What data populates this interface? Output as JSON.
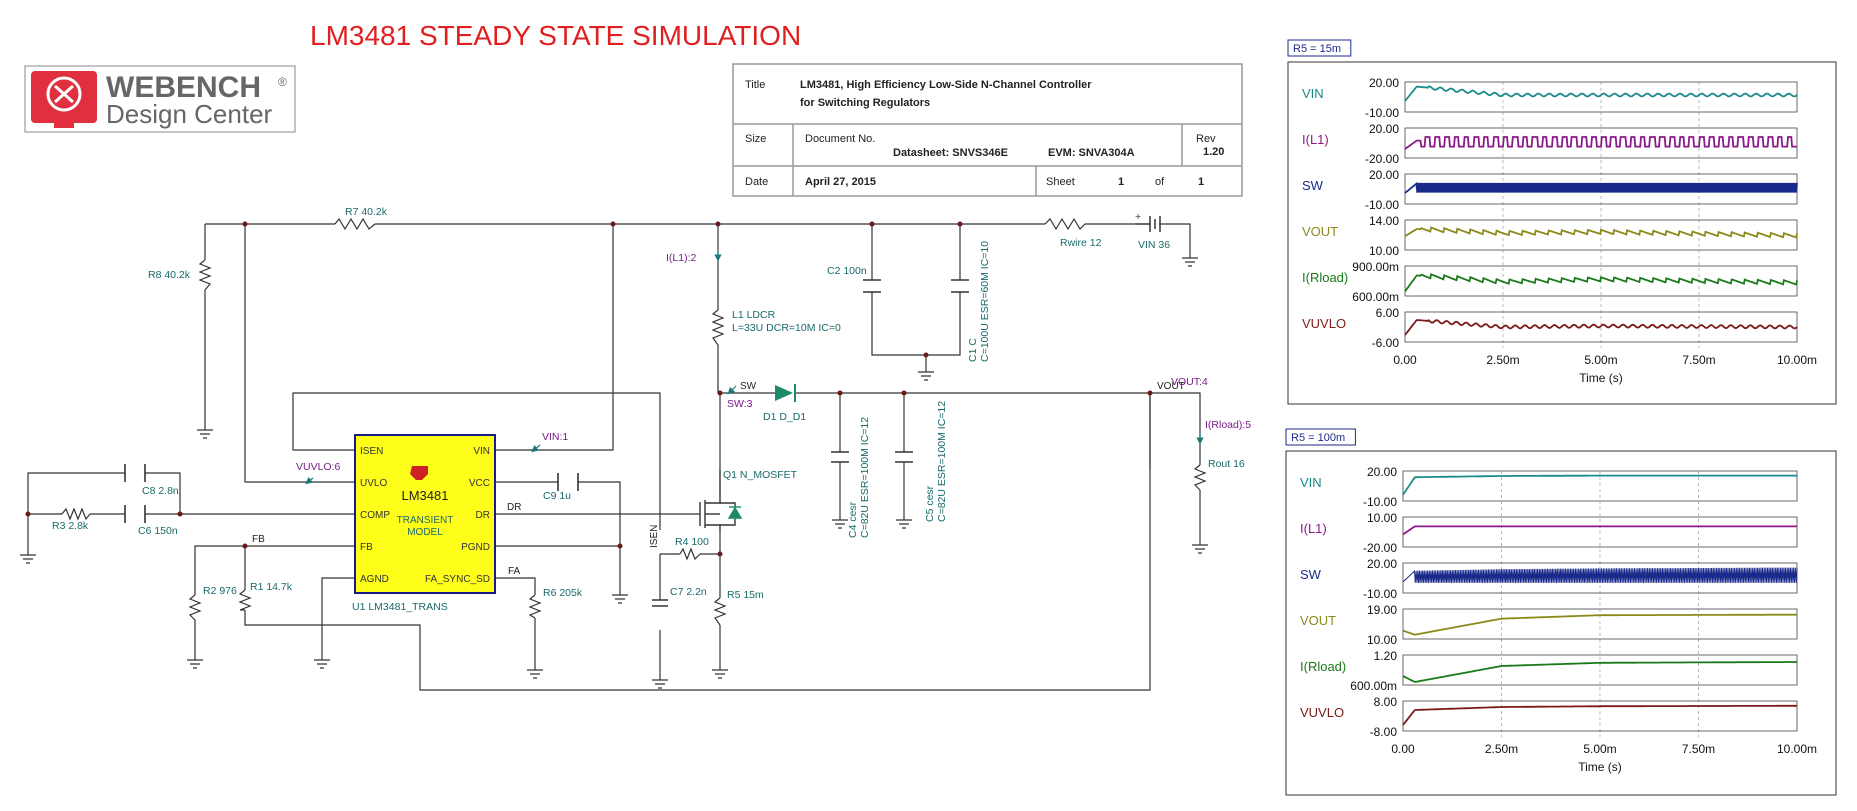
{
  "main_title": "LM3481 STEADY STATE SIMULATION",
  "logo": {
    "line1": "WEBENCH",
    "line1_mark": "®",
    "line2": "Design Center"
  },
  "title_block": {
    "title_label": "Title",
    "title_line1": "LM3481, High Efficiency Low-Side N-Channel Controller",
    "title_line2": "for Switching Regulators",
    "size_label": "Size",
    "docno_label": "Document No.",
    "datasheet": "Datasheet: SNVS346E",
    "evm": "EVM: SNVA304A",
    "rev_label": "Rev",
    "rev_value": "1.20",
    "date_label": "Date",
    "date_value": "April 27, 2015",
    "sheet_label": "Sheet",
    "sheet_value": "1",
    "of_label": "of",
    "of_value": "1"
  },
  "schematic": {
    "chip": {
      "name": "LM3481",
      "model_line1": "TRANSIENT",
      "model_line2": "MODEL",
      "ref": "U1 LM3481_TRANS",
      "pins_left": [
        "ISEN",
        "UVLO",
        "COMP",
        "FB",
        "AGND"
      ],
      "pins_right": [
        "VIN",
        "VCC",
        "DR",
        "PGND",
        "FA_SYNC_SD"
      ]
    },
    "components": {
      "r7": "R7 40.2k",
      "r8": "R8 40.2k",
      "r3": "R3 2.8k",
      "r2": "R2 976",
      "r1": "R1 14.7k",
      "r4": "R4 100",
      "r5": "R5 15m",
      "r6": "R6 205k",
      "rout": "Rout 16",
      "rwire": "Rwire 12",
      "vin": "VIN 36",
      "vin_plus": "+",
      "c8": "C8 2.8n",
      "c6": "C6 150n",
      "c9": "C9 1u",
      "c7": "C7 2.2n",
      "c2": "C2 100n",
      "c1_a": "C1 C",
      "c1_b": "C=100U ESR=60M IC=10",
      "c4_a": "C4 cesr",
      "c4_b": "C=82U ESR=100M IC=12",
      "c5_a": "C5 cesr",
      "c5_b": "C=82U ESR=100M IC=12",
      "l1_a": "L1 LDCR",
      "l1_b": "L=33U DCR=10M IC=0",
      "d1": "D1 D_D1",
      "q1": "Q1 N_MOSFET"
    },
    "nets": {
      "dr": "DR",
      "fb": "FB",
      "fa": "FA",
      "isen": "ISEN",
      "sw": "SW",
      "vout": "VOUT"
    },
    "probes": {
      "il1": "I(L1):2",
      "vin": "VIN:1",
      "vuvlo": "VUVLO:6",
      "sw": "SW:3",
      "vout": "VOUT:4",
      "irload": "I(Rload):5"
    }
  },
  "chart_data": [
    {
      "type": "line",
      "title": "R5 = 15m",
      "xlabel": "Time (s)",
      "xlim": [
        0,
        0.01
      ],
      "x_ticks": [
        "0.00",
        "2.50m",
        "5.00m",
        "7.50m",
        "10.00m"
      ],
      "grid": true,
      "series": [
        {
          "name": "VIN",
          "color": "#1a8a8a",
          "y_ticks": [
            "20.00",
            "-10.00"
          ],
          "ylim": [
            -10,
            20
          ],
          "shape": "spike-steady",
          "values": [
            0,
            18,
            7.5,
            7.5,
            7.5
          ]
        },
        {
          "name": "I(L1)",
          "color": "#8a1a8a",
          "y_ticks": [
            "20.00",
            "-20.00"
          ],
          "ylim": [
            -20,
            20
          ],
          "shape": "square-pulse",
          "values": [
            -10,
            4,
            2,
            4,
            2
          ]
        },
        {
          "name": "SW",
          "color": "#1a2a8a",
          "y_ticks": [
            "20.00",
            "-10.00"
          ],
          "ylim": [
            -10,
            20
          ],
          "shape": "switching",
          "values": [
            0,
            12,
            0,
            12,
            0
          ]
        },
        {
          "name": "VOUT",
          "color": "#8a8a1a",
          "y_ticks": [
            "14.00",
            "10.00"
          ],
          "ylim": [
            10,
            14
          ],
          "shape": "sawtooth",
          "values": [
            11.8,
            13,
            12.3,
            12.5,
            11.9
          ]
        },
        {
          "name": "I(Rload)",
          "color": "#1a7a1a",
          "y_ticks": [
            "900.00m",
            "600.00m"
          ],
          "ylim": [
            0.6,
            0.9
          ],
          "shape": "sawtooth",
          "values": [
            0.62,
            0.82,
            0.74,
            0.77,
            0.73
          ]
        },
        {
          "name": "VUVLO",
          "color": "#7a1a1a",
          "y_ticks": [
            "6.00",
            "-6.00"
          ],
          "ylim": [
            -6,
            6
          ],
          "shape": "spike-ripple",
          "values": [
            -4,
            3.5,
            0,
            0.5,
            0
          ]
        }
      ]
    },
    {
      "type": "line",
      "title": "R5 = 100m",
      "xlabel": "Time (s)",
      "xlim": [
        0,
        0.01
      ],
      "x_ticks": [
        "0.00",
        "2.50m",
        "5.00m",
        "7.50m",
        "10.00m"
      ],
      "grid": true,
      "series": [
        {
          "name": "VIN",
          "color": "#1a8a8a",
          "y_ticks": [
            "20.00",
            "-10.00"
          ],
          "ylim": [
            -10,
            20
          ],
          "shape": "rise",
          "values": [
            -6,
            16,
            17.5,
            18,
            18
          ]
        },
        {
          "name": "I(L1)",
          "color": "#8a1a8a",
          "y_ticks": [
            "10.00",
            "-20.00"
          ],
          "ylim": [
            -20,
            10
          ],
          "shape": "dip-flat",
          "values": [
            -8,
            2,
            2,
            2,
            2
          ]
        },
        {
          "name": "SW",
          "color": "#1a2a8a",
          "y_ticks": [
            "20.00",
            "-10.00"
          ],
          "ylim": [
            -10,
            20
          ],
          "shape": "filled-band",
          "values": [
            0,
            14,
            16,
            17,
            18
          ]
        },
        {
          "name": "VOUT",
          "color": "#8a8a1a",
          "y_ticks": [
            "19.00",
            "10.00"
          ],
          "ylim": [
            10,
            19
          ],
          "shape": "dip-rise",
          "values": [
            12,
            10.5,
            16.5,
            17.8,
            18
          ]
        },
        {
          "name": "I(Rload)",
          "color": "#1a7a1a",
          "y_ticks": [
            "1.20",
            "600.00m"
          ],
          "ylim": [
            0.6,
            1.2
          ],
          "shape": "dip-rise",
          "values": [
            0.75,
            0.6,
            1.0,
            1.08,
            1.1
          ]
        },
        {
          "name": "VUVLO",
          "color": "#7a1a1a",
          "y_ticks": [
            "8.00",
            "-8.00"
          ],
          "ylim": [
            -8,
            8
          ],
          "shape": "rise",
          "values": [
            -6,
            4,
            6,
            6.5,
            6.8
          ]
        }
      ]
    }
  ]
}
